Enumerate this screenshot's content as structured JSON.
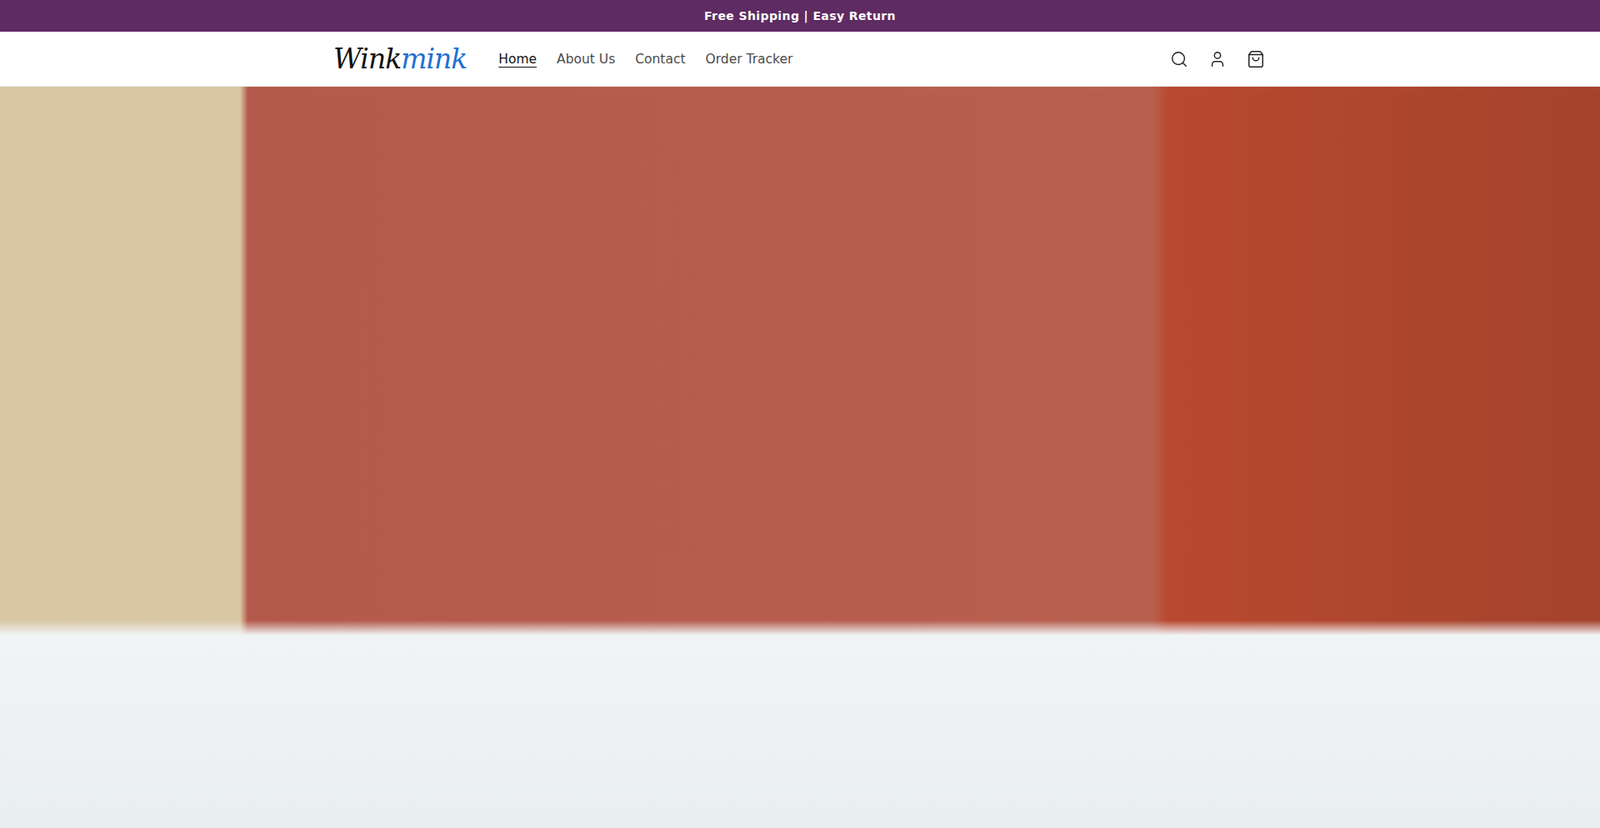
{
  "announcement": {
    "text": "Free Shipping | Easy Return"
  },
  "header": {
    "logo": [
      {
        "text": "Wink",
        "color": "#111111"
      },
      {
        "text": "mink",
        "color": "#1f6fd1"
      }
    ],
    "nav": [
      {
        "label": "Home",
        "selected": true
      },
      {
        "label": "About Us",
        "selected": false
      },
      {
        "label": "Contact",
        "selected": false
      },
      {
        "label": "Order Tracker",
        "selected": false
      }
    ]
  },
  "hero": {
    "image": "photo"
  }
}
